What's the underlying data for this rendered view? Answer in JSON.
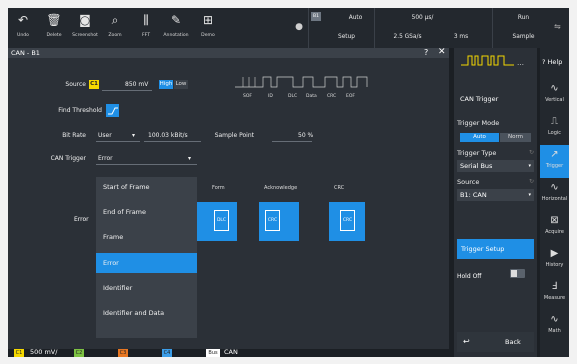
{
  "toolbar": {
    "buttons": [
      {
        "label": "Undo",
        "icon": "undo-arrow"
      },
      {
        "label": "Delete",
        "icon": "trash"
      },
      {
        "label": "Screenshot",
        "icon": "camera"
      },
      {
        "label": "Zoom",
        "icon": "magnifier"
      },
      {
        "label": "FFT",
        "icon": "fft-bars"
      },
      {
        "label": "Annotation",
        "icon": "pencil"
      },
      {
        "label": "Demo",
        "icon": "demo-board"
      }
    ],
    "bus_tag": "B1",
    "trigger_mode": "Auto",
    "setup": "Setup",
    "time_scale": "500 µs/",
    "sample_rate": "2.5 GSa/s",
    "record_length": "3 ms",
    "run_state": "Run",
    "acq_mode": "Sample"
  },
  "dialog": {
    "title": "CAN - B1",
    "help_glyph": "?",
    "close_glyph": "✕",
    "source_label": "Source",
    "source_channel": "C1",
    "source_value": "850 mV",
    "high_label": "High",
    "low_label": "Low",
    "frame_labels": [
      "SOF",
      "ID",
      "DLC",
      "Data",
      "CRC",
      "EOF"
    ],
    "find_threshold_label": "Find Threshold",
    "bit_rate_label": "Bit Rate",
    "bit_rate_mode": "User",
    "bit_rate_value": "100.03 kBit/s",
    "sample_point_label": "Sample Point",
    "sample_point_value": "50 %",
    "can_trigger_label": "CAN Trigger",
    "can_trigger_value": "Error",
    "error_label": "Error",
    "error_headers": [
      "Form",
      "Acknowledge",
      "CRC"
    ],
    "error_cells": [
      "DLC",
      "CRC",
      "CRC"
    ],
    "menu_items": [
      {
        "label": "Start of Frame",
        "selected": false
      },
      {
        "label": "End of Frame",
        "selected": false
      },
      {
        "label": "Frame",
        "selected": false
      },
      {
        "label": "Error",
        "selected": true
      },
      {
        "label": "Identifier",
        "selected": false
      },
      {
        "label": "Identifier and Data",
        "selected": false
      }
    ]
  },
  "panel": {
    "title": "CAN Trigger",
    "trigger_mode_label": "Trigger Mode",
    "mode_auto": "Auto",
    "mode_norm": "Norm",
    "trigger_type_label": "Trigger Type",
    "trigger_type_value": "Serial Bus",
    "source_label": "Source",
    "source_value": "B1: CAN",
    "trigger_setup": "Trigger Setup",
    "hold_off": "Hold Off",
    "back": "Back"
  },
  "sidenav": {
    "help": "? Help",
    "items": [
      {
        "label": "Vertical",
        "icon": "wave-v"
      },
      {
        "label": "Logic",
        "icon": "logic"
      },
      {
        "label": "Trigger",
        "icon": "trigger",
        "active": true
      },
      {
        "label": "Horizontal",
        "icon": "wave-h"
      },
      {
        "label": "Acquire",
        "icon": "acquire"
      },
      {
        "label": "History",
        "icon": "play"
      },
      {
        "label": "Measure",
        "icon": "measure"
      },
      {
        "label": "Math",
        "icon": "math"
      }
    ]
  },
  "bottombar": {
    "c1": "C1",
    "c1_scale": "500 mV/",
    "c2": "C2",
    "c3": "C3",
    "c4": "C4",
    "bus": "Bus",
    "bus_value": "CAN",
    "colors": {
      "c1": "#f5d800",
      "c2": "#7dc242",
      "c3": "#e87722",
      "c4": "#3b9de8"
    }
  }
}
